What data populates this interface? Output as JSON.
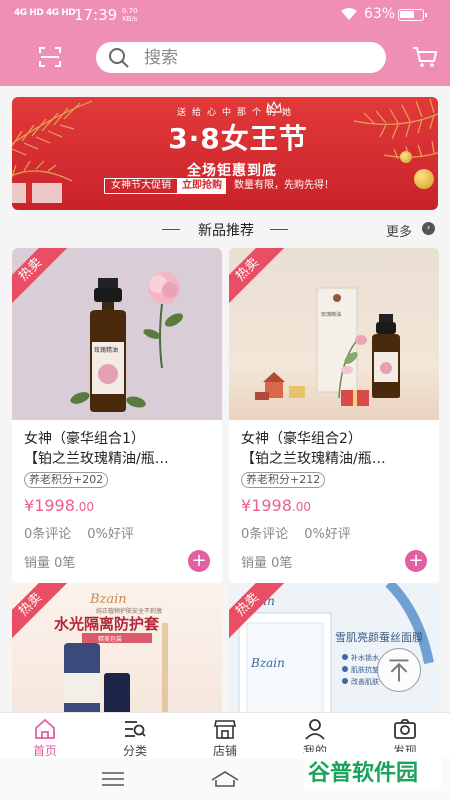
{
  "status_bar": {
    "signal1": "4G HD",
    "signal2": "4G HD",
    "time": "17:39",
    "speed_value": "0.70",
    "speed_unit": "KB/s",
    "battery": "63%"
  },
  "header": {
    "search_placeholder": "搜索",
    "scan_icon": "scan-icon",
    "cart_icon": "cart-icon"
  },
  "banner": {
    "top_line": "送给心中那个的她",
    "headline": "3·8女王节",
    "line2": "全场钜惠到底",
    "promo_left": "女神节大促销",
    "promo_button": "立即抢购",
    "promo_right": "数量有限，先购先得！"
  },
  "section": {
    "title": "新品推荐",
    "more": "更多"
  },
  "products": [
    {
      "badge": "热卖",
      "name_line1": "女神（豪华组合1）",
      "name_line2": "【铂之兰玫瑰精油/瓶…",
      "tag": "养老积分+202",
      "price_symbol": "¥",
      "price_int": "1998",
      "price_dec": ".00",
      "reviews": "0条评论",
      "good_rate": "0%好评",
      "sales": "销量 0笔",
      "bottle_label": "玫瑰精油"
    },
    {
      "badge": "热卖",
      "name_line1": "女神（豪华组合2）",
      "name_line2": "【铂之兰玫瑰精油/瓶…",
      "tag": "养老积分+212",
      "price_symbol": "¥",
      "price_int": "1998",
      "price_dec": ".00",
      "reviews": "0条评论",
      "good_rate": "0%好评",
      "sales": "销量 0笔",
      "bottle_label": "玫瑰精油"
    }
  ],
  "products_row2": [
    {
      "badge": "热卖",
      "brand": "Bzain",
      "subtitle": "纯正植物护肤安全不刺激",
      "title": "水光隔离防护套",
      "ribbon": "精美包装"
    },
    {
      "badge": "热卖",
      "brand": "Bzain",
      "title": "雪肌亮颜蚕丝面膜",
      "features": [
        "补水锁水",
        "肌肤抗皱",
        "改善肌肤"
      ]
    }
  ],
  "tabs": [
    {
      "label": "首页",
      "icon": "home-icon",
      "active": true
    },
    {
      "label": "分类",
      "icon": "category-icon",
      "active": false
    },
    {
      "label": "店铺",
      "icon": "store-icon",
      "active": false
    },
    {
      "label": "我的",
      "icon": "user-icon",
      "active": false
    },
    {
      "label": "发现",
      "icon": "camera-icon",
      "active": false
    }
  ],
  "watermark": "谷普软件园",
  "colors": {
    "header_pink": "#ef8fb4",
    "accent_pink": "#e25fa1",
    "price_pink": "#ec5f8e",
    "hot_red": "#e94e65",
    "banner_red": "#d42a2f"
  }
}
